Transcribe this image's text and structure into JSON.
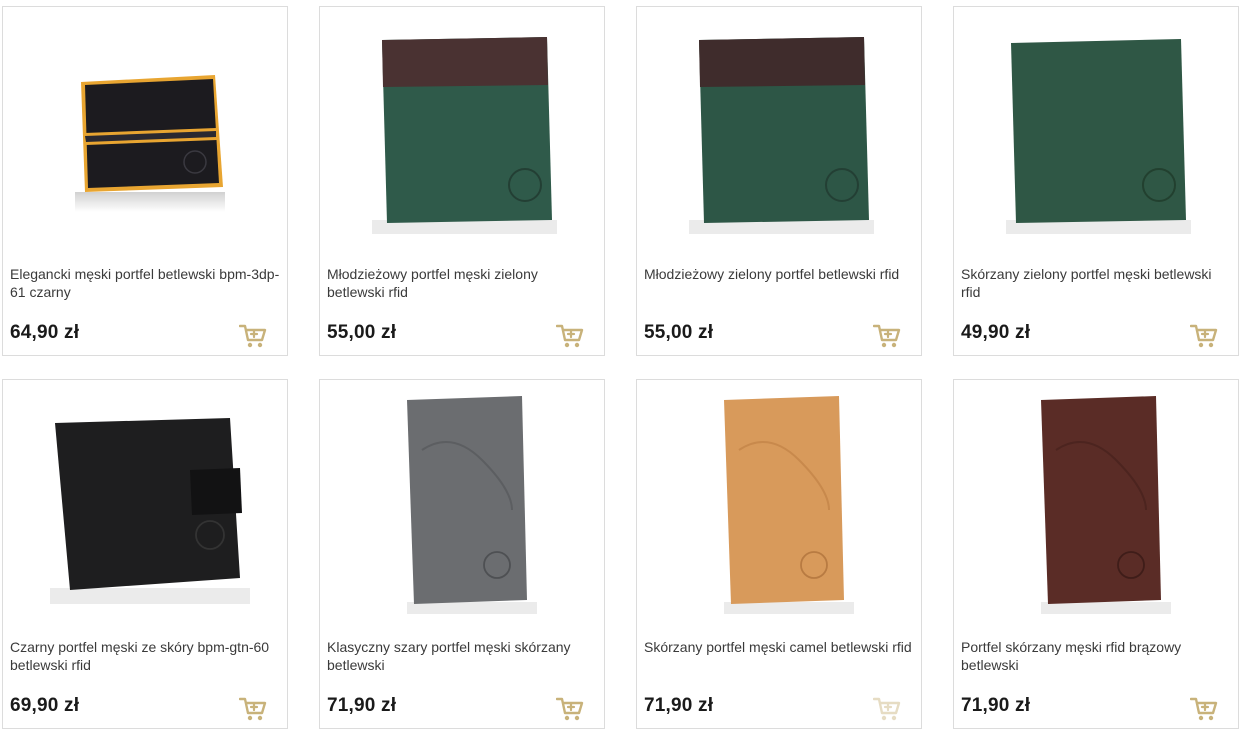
{
  "colors": {
    "card_border": "#dcdcdc",
    "price_text": "#1a1a1a",
    "cart_icon": "#c8b27a",
    "cart_icon_faded": "#e6dcc3"
  },
  "products": [
    {
      "title": "Elegancki męski portfel betlewski bpm-3dp-61 czarny",
      "price": "64,90 zł",
      "wallet_color": "#1c1b1f",
      "accent_color": "#e8a531",
      "cart_icon": "cart-icon"
    },
    {
      "title": "Młodzieżowy portfel męski zielony betlewski rfid",
      "price": "55,00 zł",
      "wallet_color": "#2f5a4a",
      "accent_color": "#4a3232",
      "cart_icon": "cart-icon"
    },
    {
      "title": "Młodzieżowy zielony portfel betlewski rfid",
      "price": "55,00 zł",
      "wallet_color": "#2d5646",
      "accent_color": "#3f2c2c",
      "cart_icon": "cart-icon"
    },
    {
      "title": "Skórzany zielony portfel męski betlewski rfid",
      "price": "49,90 zł",
      "wallet_color": "#2f5745",
      "accent_color": "",
      "cart_icon": "cart-icon"
    },
    {
      "title": "Czarny portfel męski ze skóry bpm-gtn-60 betlewski rfid",
      "price": "69,90 zł",
      "wallet_color": "#1e1e1f",
      "accent_color": "",
      "cart_icon": "cart-icon"
    },
    {
      "title": "Klasyczny szary portfel męski skórzany betlewski",
      "price": "71,90 zł",
      "wallet_color": "#6b6d70",
      "accent_color": "",
      "cart_icon": "cart-icon"
    },
    {
      "title": "Skórzany portfel męski camel betlewski rfid",
      "price": "71,90 zł",
      "wallet_color": "#d89a5b",
      "accent_color": "",
      "cart_icon": "cart-icon"
    },
    {
      "title": "Portfel skórzany męski rfid brązowy betlewski",
      "price": "71,90 zł",
      "wallet_color": "#5a2c26",
      "accent_color": "",
      "cart_icon": "cart-icon"
    }
  ]
}
